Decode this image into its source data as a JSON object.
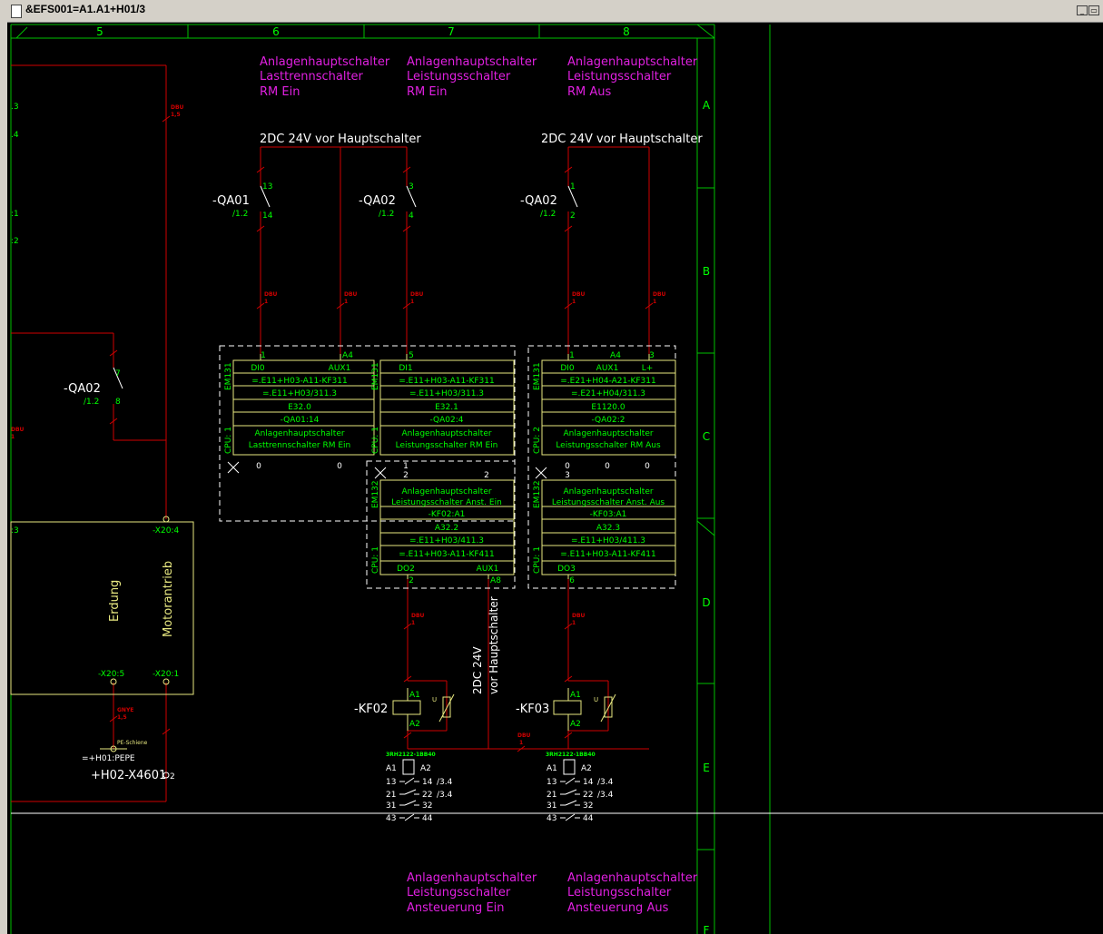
{
  "window": {
    "title": "&EFS001=A1.A1+H01/3",
    "btn_min": "_",
    "btn_restore": "▭"
  },
  "columns": [
    "5",
    "6",
    "7",
    "8"
  ],
  "rows": [
    "A",
    "B",
    "C",
    "D",
    "E",
    "F"
  ],
  "headers": {
    "col6": [
      "Anlagenhauptschalter",
      "Lasttrennschalter",
      "RM Ein"
    ],
    "col7": [
      "Anlagenhauptschalter",
      "Leistungsschalter",
      "RM Ein"
    ],
    "col8": [
      "Anlagenhauptschalter",
      "Leistungsschalter",
      "RM Aus"
    ]
  },
  "footers": {
    "col7": [
      "Anlagenhauptschalter",
      "Leistungsschalter",
      "Ansteuerung Ein"
    ],
    "col8": [
      "Anlagenhauptschalter",
      "Leistungsschalter",
      "Ansteuerung Aus"
    ]
  },
  "supply_labels": [
    "2DC 24V vor Hauptschalter",
    "2DC 24V vor Hauptschalter"
  ],
  "supply_vertical": [
    "2DC 24V",
    "vor Hauptschalter"
  ],
  "contacts": [
    {
      "name": "-QA01",
      "ref": "/1.2",
      "t1": "13",
      "t2": "14"
    },
    {
      "name": "-QA02",
      "ref": "/1.2",
      "t1": "3",
      "t2": "4"
    },
    {
      "name": "-QA02",
      "ref": "/1.2",
      "t1": "1",
      "t2": "2"
    },
    {
      "name": "-QA02",
      "ref": "/1.2",
      "t1": "7",
      "t2": "8"
    }
  ],
  "wire_label": "DBU",
  "wire_label_num": "1",
  "wire_label2": "GNYE",
  "wire_label2_num": "1,5",
  "wire_label3_num": "1,5",
  "modules": {
    "em131_label": "EM131",
    "em132_label": "EM132",
    "cpu_label": "CPU: 1",
    "cpu2_label": "CPU: 2",
    "mod1": {
      "terms": [
        "1",
        "A4"
      ],
      "head": [
        "DI0",
        "AUX1"
      ],
      "rows": [
        "=.E11+H03-A11-KF311",
        "=.E11+H03/311.3",
        "E32.0",
        "-QA01:14",
        "Anlagenhauptschalter",
        "Lasttrennschalter RM Ein"
      ],
      "bottom": [
        "0",
        "0"
      ]
    },
    "mod2": {
      "terms": [
        "5"
      ],
      "head": [
        "DI1"
      ],
      "rows": [
        "=.E11+H03-A11-KF311",
        "=.E11+H03/311.3",
        "E32.1",
        "-QA02:4",
        "Anlagenhauptschalter",
        "Leistungsschalter RM Ein"
      ],
      "bottom": [
        "1",
        "2",
        "2"
      ]
    },
    "mod3": {
      "terms": [
        "1",
        "A4",
        "3"
      ],
      "head": [
        "DI0",
        "AUX1",
        "L+"
      ],
      "rows": [
        "=.E21+H04-A21-KF311",
        "=.E21+H04/311.3",
        "E1120.0",
        "-QA02:2",
        "Anlagenhauptschalter",
        "Leistungsschalter RM Aus"
      ],
      "bottom": [
        "0",
        "0",
        "0",
        "3"
      ]
    },
    "mod4": {
      "rows": [
        "Anlagenhauptschalter",
        "Leistungsschalter Anst. Ein",
        "-KF02:A1",
        "A32.2",
        "=.E11+H03/411.3",
        "=.E11+H03-A11-KF411"
      ],
      "foot": [
        "DO2",
        "AUX1"
      ],
      "terms": [
        "2",
        "A8"
      ]
    },
    "mod5": {
      "rows": [
        "Anlagenhauptschalter",
        "Leistungsschalter Anst. Aus",
        "-KF03:A1",
        "A32.3",
        "=.E11+H03/411.3",
        "=.E11+H03-A11-KF411"
      ],
      "foot": [
        "DO3"
      ],
      "terms": [
        "6"
      ]
    }
  },
  "relays": [
    {
      "name": "-KF02",
      "a1": "A1",
      "a2": "A2",
      "type": "3RH2122-1BB40",
      "contacts": [
        [
          "13",
          "14",
          "/3.4"
        ],
        [
          "21",
          "22",
          "/3.4"
        ],
        [
          "31",
          "32",
          ""
        ],
        [
          "43",
          "44",
          ""
        ]
      ]
    },
    {
      "name": "-KF03",
      "a1": "A1",
      "a2": "A2",
      "type": "3RH2122-1BB40",
      "contacts": [
        [
          "13",
          "14",
          "/3.4"
        ],
        [
          "21",
          "22",
          "/3.4"
        ],
        [
          "31",
          "32",
          ""
        ],
        [
          "43",
          "44",
          ""
        ]
      ]
    }
  ],
  "varistor_label": "U",
  "motor": {
    "label1": "Erdung",
    "label2": "Motorantrieb",
    "t_top": "-X20:4",
    "t_b1": "-X20:5",
    "t_b2": "-X20:1"
  },
  "pe": {
    "rail": "PE-Schiene",
    "tag": "=+H01:PEPE",
    "xref": "+H02-X4601",
    "num": "2"
  },
  "left_labels": [
    ".3",
    ".4",
    ":1",
    ":2",
    ":3",
    "DBU",
    "1"
  ],
  "colors": {
    "grid": "#00c000",
    "wire": "#d00000",
    "text": "#00ff00",
    "magenta": "#e020e0",
    "yellow": "#e8e880",
    "white": "#ffffff"
  }
}
